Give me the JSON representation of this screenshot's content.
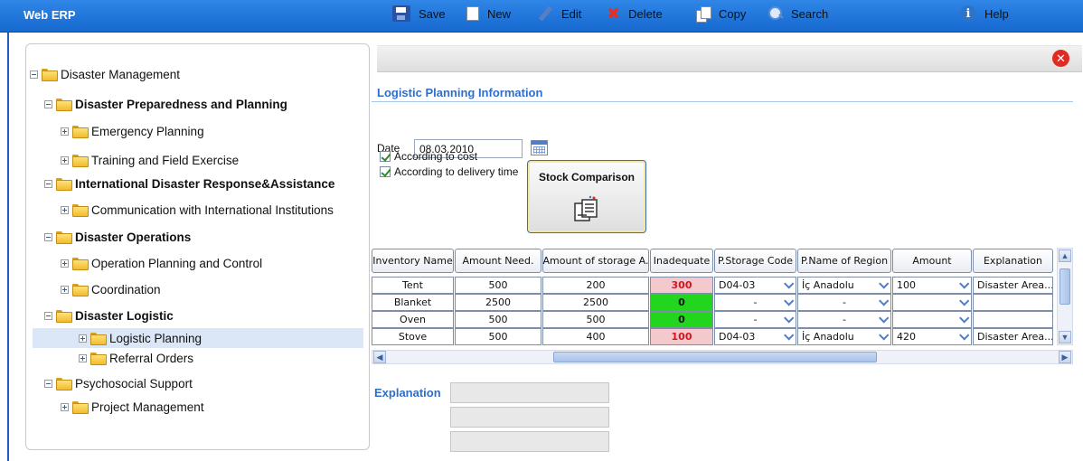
{
  "window": {
    "title": "Web ERP"
  },
  "tree": {
    "items": [
      {
        "label": "Disaster Management",
        "level": 0,
        "expanded": true,
        "bold": false
      },
      {
        "label": "Disaster Preparedness and Planning",
        "level": 1,
        "expanded": true,
        "bold": true
      },
      {
        "label": "Emergency Planning",
        "level": 2,
        "expanded": false,
        "bold": false
      },
      {
        "label": "Training and Field Exercise",
        "level": 2,
        "expanded": false,
        "bold": false
      },
      {
        "label": "International Disaster Response&Assistance",
        "level": 1,
        "expanded": true,
        "bold": true
      },
      {
        "label": "Communication with International Institutions",
        "level": 2,
        "expanded": false,
        "bold": false
      },
      {
        "label": "Disaster Operations",
        "level": 1,
        "expanded": true,
        "bold": true
      },
      {
        "label": "Operation Planning and Control",
        "level": 2,
        "expanded": false,
        "bold": false
      },
      {
        "label": "Coordination",
        "level": 2,
        "expanded": false,
        "bold": false
      },
      {
        "label": "Disaster Logistic",
        "level": 1,
        "expanded": true,
        "bold": true
      },
      {
        "label": "Logistic Planning",
        "level": 3,
        "expanded": false,
        "bold": false,
        "selected": true
      },
      {
        "label": "Referral Orders",
        "level": 3,
        "expanded": false,
        "bold": false
      },
      {
        "label": "Psychosocial Support",
        "level": 1,
        "expanded": true,
        "bold": false
      },
      {
        "label": "Project Management",
        "level": 2,
        "expanded": false,
        "bold": false
      }
    ]
  },
  "toolbar": {
    "save": "Save",
    "new": "New",
    "edit": "Edit",
    "delete": "Delete",
    "copy": "Copy",
    "search": "Search",
    "help": "Help"
  },
  "form": {
    "section_title": "Logistic Planning Information",
    "date_label": "Date",
    "date_value": "08.03.2010",
    "checkbox_cost": "According to cost",
    "checkbox_delivery": "According to delivery time",
    "stock_button": "Stock Comparison"
  },
  "grid": {
    "columns": [
      "Inventory Name",
      "Amount Need.",
      "Amount of storage A.",
      "Inadequate",
      "P.Storage Code",
      "P.Name of Region",
      "Amount",
      "Explanation"
    ],
    "rows": [
      {
        "name": "Tent",
        "need": "500",
        "storage": "200",
        "inadequate": "300",
        "status": "red",
        "code": "D04-03",
        "region": "İç Anadolu",
        "amount": "100",
        "explanation": "Disaster Area...."
      },
      {
        "name": "Blanket",
        "need": "2500",
        "storage": "2500",
        "inadequate": "0",
        "status": "green",
        "code": "-",
        "region": "-",
        "amount": "",
        "explanation": ""
      },
      {
        "name": "Oven",
        "need": "500",
        "storage": "500",
        "inadequate": "0",
        "status": "green",
        "code": "-",
        "region": "-",
        "amount": "",
        "explanation": ""
      },
      {
        "name": "Stove",
        "need": "500",
        "storage": "400",
        "inadequate": "100",
        "status": "red",
        "code": "D04-03",
        "region": "İç Anadolu",
        "amount": "420",
        "explanation": "Disaster Area...."
      }
    ]
  },
  "explanation": {
    "title": "Explanation",
    "values": [
      "",
      "",
      ""
    ]
  },
  "colors": {
    "titlebar": "#1a6fd8",
    "accent": "#2f6fcb",
    "inadequate_red": "#f3c9ce",
    "adequate_green": "#22d61e"
  }
}
